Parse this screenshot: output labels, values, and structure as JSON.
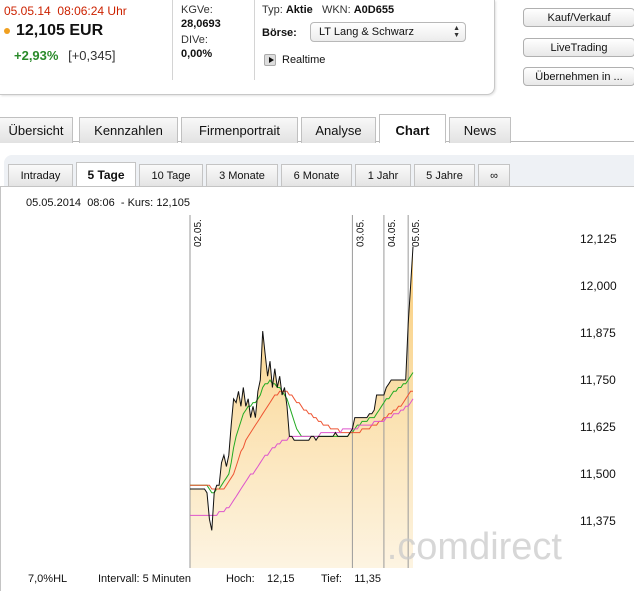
{
  "quote": {
    "date": "05.05.14",
    "time": "08:06:24 Uhr",
    "price": "12,105 EUR",
    "change_pct": "+2,93%",
    "change_abs": "[+0,345]",
    "dot_color": "#f0a020",
    "up_color": "#2a8a2a",
    "time_color": "#cc2200"
  },
  "fundamentals": {
    "kgv_label": "KGVe:",
    "kgv_value": "28,0693",
    "div_label": "DIVe:",
    "div_value": "0,00%"
  },
  "info": {
    "typ_label": "Typ:",
    "typ_value": "Aktie",
    "wkn_label": "WKN:",
    "wkn_value": "A0D655",
    "boerse_label": "Börse:",
    "boerse_value": "LT Lang & Schwarz",
    "realtime_label": "Realtime",
    "play_icon": "play-icon"
  },
  "actions": {
    "kauf_verkauf": "Kauf/Verkauf",
    "livetrading": "LiveTrading",
    "uebernehmen": "Übernehmen in ..."
  },
  "main_tabs": [
    "Übersicht",
    "Kennzahlen",
    "Firmenportrait",
    "Analyse",
    "Chart",
    "News"
  ],
  "active_main_tab": "Chart",
  "period_tabs": [
    "Intraday",
    "5 Tage",
    "10 Tage",
    "3 Monate",
    "6 Monate",
    "1 Jahr",
    "5 Jahre",
    "∞"
  ],
  "active_period_tab": "5 Tage",
  "chart_header": {
    "date": "05.05.2014",
    "time": "08:06",
    "kurs_label": "- Kurs:",
    "kurs_value": "12,105"
  },
  "chart_footer": {
    "hl": "7,0%HL",
    "intervall": "Intervall: 5 Minuten",
    "hoch_label": "Hoch:",
    "hoch_value": "12,15",
    "tief_label": "Tief:",
    "tief_value": "11,35"
  },
  "watermark": ".comdirect",
  "chart_data": {
    "type": "area",
    "title": "",
    "xlabel": "",
    "ylabel": "",
    "y_ticks": [
      "12,125",
      "12,000",
      "11,875",
      "11,750",
      "11,625",
      "11,500",
      "11,375"
    ],
    "y_tick_values": [
      12.125,
      12.0,
      11.875,
      11.75,
      11.625,
      11.5,
      11.375
    ],
    "ylim": [
      11.27,
      12.25
    ],
    "day_markers": [
      {
        "label": "02.05.",
        "index": 0
      },
      {
        "label": "03.05.",
        "index": 67
      },
      {
        "label": "04.05.",
        "index": 80
      },
      {
        "label": "05.05.",
        "index": 90
      }
    ],
    "n_points": 93,
    "series": [
      {
        "values": [
          11.46,
          11.46,
          11.46,
          11.46,
          11.46,
          11.46,
          11.46,
          11.45,
          11.38,
          11.35,
          11.45,
          11.47,
          11.47,
          11.53,
          11.55,
          11.52,
          11.55,
          11.63,
          11.7,
          11.69,
          11.72,
          11.68,
          11.73,
          11.68,
          11.7,
          11.65,
          11.68,
          11.65,
          11.72,
          11.75,
          11.88,
          11.82,
          11.76,
          11.8,
          11.73,
          11.78,
          11.73,
          11.76,
          11.71,
          11.73,
          11.68,
          11.6,
          11.6,
          11.59,
          11.59,
          11.59,
          11.59,
          11.59,
          11.59,
          11.59,
          11.6,
          11.6,
          11.59,
          11.6,
          11.6,
          11.6,
          11.6,
          11.6,
          11.6,
          11.6,
          11.61,
          11.6,
          11.6,
          11.6,
          11.6,
          11.6,
          11.61,
          11.62,
          11.65,
          11.65,
          11.65,
          11.65,
          11.65,
          11.65,
          11.66,
          11.66,
          11.67,
          11.71,
          11.71,
          11.71,
          11.71,
          11.73,
          11.74,
          11.75,
          11.75,
          11.75,
          11.75,
          11.75,
          11.75,
          11.75,
          11.9,
          12.0,
          12.105
        ],
        "color": "#111111",
        "fill_top": "#f9cd7a",
        "fill_bottom": "#fdf4e2"
      },
      {
        "values": [
          11.47,
          11.47,
          11.47,
          11.47,
          11.47,
          11.47,
          11.47,
          11.47,
          11.46,
          11.45,
          11.45,
          11.46,
          11.46,
          11.47,
          11.48,
          11.49,
          11.5,
          11.53,
          11.57,
          11.6,
          11.62,
          11.64,
          11.66,
          11.67,
          11.68,
          11.68,
          11.69,
          11.69,
          11.7,
          11.71,
          11.73,
          11.74,
          11.74,
          11.75,
          11.74,
          11.74,
          11.73,
          11.73,
          11.72,
          11.71,
          11.7,
          11.68,
          11.66,
          11.64,
          11.62,
          11.61,
          11.6,
          11.6,
          11.6,
          11.6,
          11.6,
          11.6,
          11.6,
          11.6,
          11.6,
          11.6,
          11.6,
          11.6,
          11.6,
          11.6,
          11.6,
          11.6,
          11.6,
          11.6,
          11.6,
          11.6,
          11.61,
          11.61,
          11.62,
          11.63,
          11.63,
          11.64,
          11.64,
          11.64,
          11.65,
          11.65,
          11.65,
          11.66,
          11.67,
          11.68,
          11.69,
          11.7,
          11.7,
          11.71,
          11.72,
          11.72,
          11.73,
          11.73,
          11.74,
          11.74,
          11.75,
          11.76,
          11.77
        ],
        "color": "#22aa22"
      },
      {
        "values": [
          11.47,
          11.47,
          11.47,
          11.47,
          11.47,
          11.47,
          11.47,
          11.47,
          11.47,
          11.46,
          11.46,
          11.46,
          11.46,
          11.46,
          11.46,
          11.47,
          11.48,
          11.49,
          11.5,
          11.52,
          11.54,
          11.56,
          11.57,
          11.59,
          11.6,
          11.61,
          11.62,
          11.63,
          11.64,
          11.65,
          11.66,
          11.67,
          11.68,
          11.69,
          11.7,
          11.71,
          11.71,
          11.72,
          11.72,
          11.72,
          11.72,
          11.71,
          11.71,
          11.7,
          11.69,
          11.69,
          11.68,
          11.67,
          11.67,
          11.66,
          11.66,
          11.65,
          11.65,
          11.64,
          11.64,
          11.63,
          11.63,
          11.63,
          11.62,
          11.62,
          11.62,
          11.62,
          11.61,
          11.61,
          11.61,
          11.61,
          11.61,
          11.61,
          11.61,
          11.61,
          11.61,
          11.62,
          11.62,
          11.62,
          11.62,
          11.63,
          11.63,
          11.63,
          11.64,
          11.64,
          11.65,
          11.65,
          11.66,
          11.66,
          11.67,
          11.67,
          11.68,
          11.68,
          11.69,
          11.7,
          11.71,
          11.72,
          11.72
        ],
        "color": "#ee5533"
      },
      {
        "values": [
          11.39,
          11.39,
          11.39,
          11.39,
          11.39,
          11.39,
          11.39,
          11.39,
          11.39,
          11.39,
          11.39,
          11.39,
          11.4,
          11.4,
          11.4,
          11.41,
          11.41,
          11.42,
          11.43,
          11.44,
          11.45,
          11.46,
          11.47,
          11.48,
          11.49,
          11.5,
          11.5,
          11.51,
          11.52,
          11.53,
          11.54,
          11.55,
          11.55,
          11.56,
          11.57,
          11.57,
          11.58,
          11.58,
          11.59,
          11.59,
          11.59,
          11.6,
          11.6,
          11.6,
          11.6,
          11.6,
          11.6,
          11.6,
          11.6,
          11.6,
          11.6,
          11.6,
          11.6,
          11.6,
          11.61,
          11.61,
          11.61,
          11.61,
          11.61,
          11.61,
          11.61,
          11.61,
          11.61,
          11.62,
          11.62,
          11.62,
          11.62,
          11.62,
          11.62,
          11.62,
          11.63,
          11.63,
          11.63,
          11.63,
          11.63,
          11.63,
          11.64,
          11.64,
          11.64,
          11.64,
          11.64,
          11.65,
          11.65,
          11.65,
          11.66,
          11.66,
          11.66,
          11.67,
          11.67,
          11.68,
          11.68,
          11.69,
          11.7
        ],
        "color": "#dd55cc"
      }
    ],
    "grid": false
  }
}
